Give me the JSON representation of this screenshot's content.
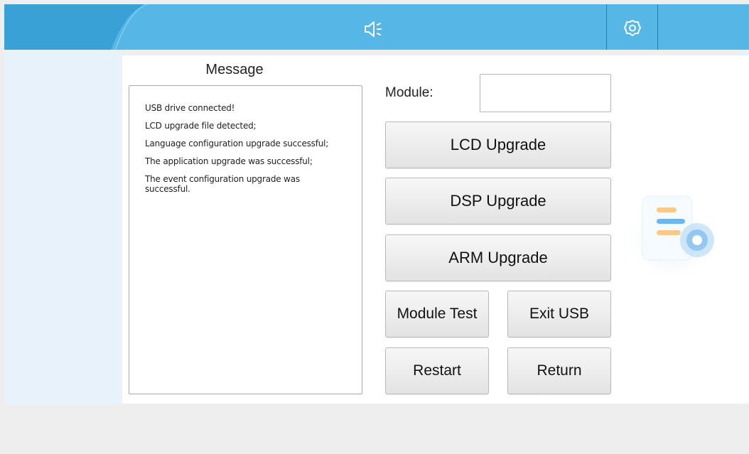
{
  "header": {
    "accent_color": "#56b7e6",
    "speaker_icon": "speaker-icon",
    "settings_icon": "gear-icon"
  },
  "message": {
    "title": "Message",
    "lines": [
      "USB drive connected!",
      "LCD upgrade file detected;",
      "Language configuration upgrade successful;",
      "The application upgrade was successful;",
      "The event configuration upgrade was successful."
    ]
  },
  "module": {
    "label": "Module:",
    "value": ""
  },
  "buttons": {
    "lcd_upgrade": "LCD Upgrade",
    "dsp_upgrade": "DSP Upgrade",
    "arm_upgrade": "ARM Upgrade",
    "module_test": "Module Test",
    "exit_usb": "Exit USB",
    "restart": "Restart",
    "return": "Return"
  },
  "decoration": {
    "icon": "document-settings-icon"
  }
}
